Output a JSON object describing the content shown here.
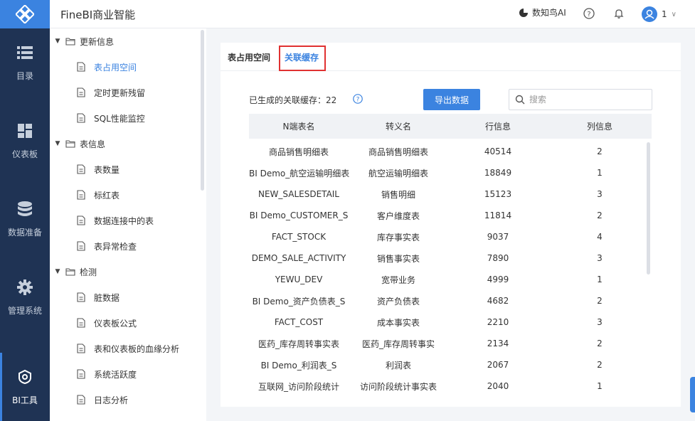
{
  "app": {
    "title": "FineBI商业智能"
  },
  "header": {
    "ai_label": "数知鸟AI",
    "user_label": "1"
  },
  "leftnav": {
    "items": [
      {
        "label": "目录",
        "icon": "list-icon"
      },
      {
        "label": "仪表板",
        "icon": "dashboard-icon"
      },
      {
        "label": "数据准备",
        "icon": "database-icon"
      },
      {
        "label": "管理系统",
        "icon": "gear-icon"
      },
      {
        "label": "BI工具",
        "icon": "bi-tool-icon",
        "active": true
      }
    ]
  },
  "tree": {
    "groups": [
      {
        "label": "更新信息",
        "items": [
          "表占用空间",
          "定时更新残留",
          "SQL性能监控"
        ]
      },
      {
        "label": "表信息",
        "items": [
          "表数量",
          "标红表",
          "数据连接中的表",
          "表异常检查"
        ]
      },
      {
        "label": "检测",
        "items": [
          "脏数据",
          "仪表板公式",
          "表和仪表板的血缘分析",
          "系统活跃度",
          "日志分析"
        ]
      }
    ],
    "selected": "表占用空间"
  },
  "tabs": [
    {
      "label": "表占用空间"
    },
    {
      "label": "关联缓存",
      "active": true
    }
  ],
  "summary": {
    "label": "已生成的关联缓存：",
    "count": "22"
  },
  "export_button": "导出数据",
  "search": {
    "placeholder": "搜索",
    "value": ""
  },
  "table": {
    "columns": [
      "N端表名",
      "转义名",
      "行信息",
      "列信息"
    ],
    "rows": [
      [
        "商品销售明细表",
        "商品销售明细表",
        "40514",
        "2"
      ],
      [
        "BI Demo_航空运输明细表",
        "航空运输明细表",
        "18849",
        "1"
      ],
      [
        "NEW_SALESDETAIL",
        "销售明细",
        "15123",
        "3"
      ],
      [
        "BI Demo_CUSTOMER_S",
        "客户维度表",
        "11814",
        "2"
      ],
      [
        "FACT_STOCK",
        "库存事实表",
        "9037",
        "4"
      ],
      [
        "DEMO_SALE_ACTIVITY",
        "销售事实表",
        "7890",
        "3"
      ],
      [
        "YEWU_DEV",
        "宽带业务",
        "4999",
        "1"
      ],
      [
        "BI Demo_资产负债表_S",
        "资产负债表",
        "4682",
        "2"
      ],
      [
        "FACT_COST",
        "成本事实表",
        "2210",
        "3"
      ],
      [
        "医药_库存周转事实表",
        "医药_库存周转事实",
        "2134",
        "2"
      ],
      [
        "BI Demo_利润表_S",
        "利润表",
        "2067",
        "2"
      ],
      [
        "互联网_访问阶段统计",
        "访问阶段统计事实表",
        "2040",
        "1"
      ]
    ]
  },
  "colors": {
    "accent": "#3b83e0",
    "nav_bg": "#1f3354",
    "highlight_border": "#e03131"
  }
}
